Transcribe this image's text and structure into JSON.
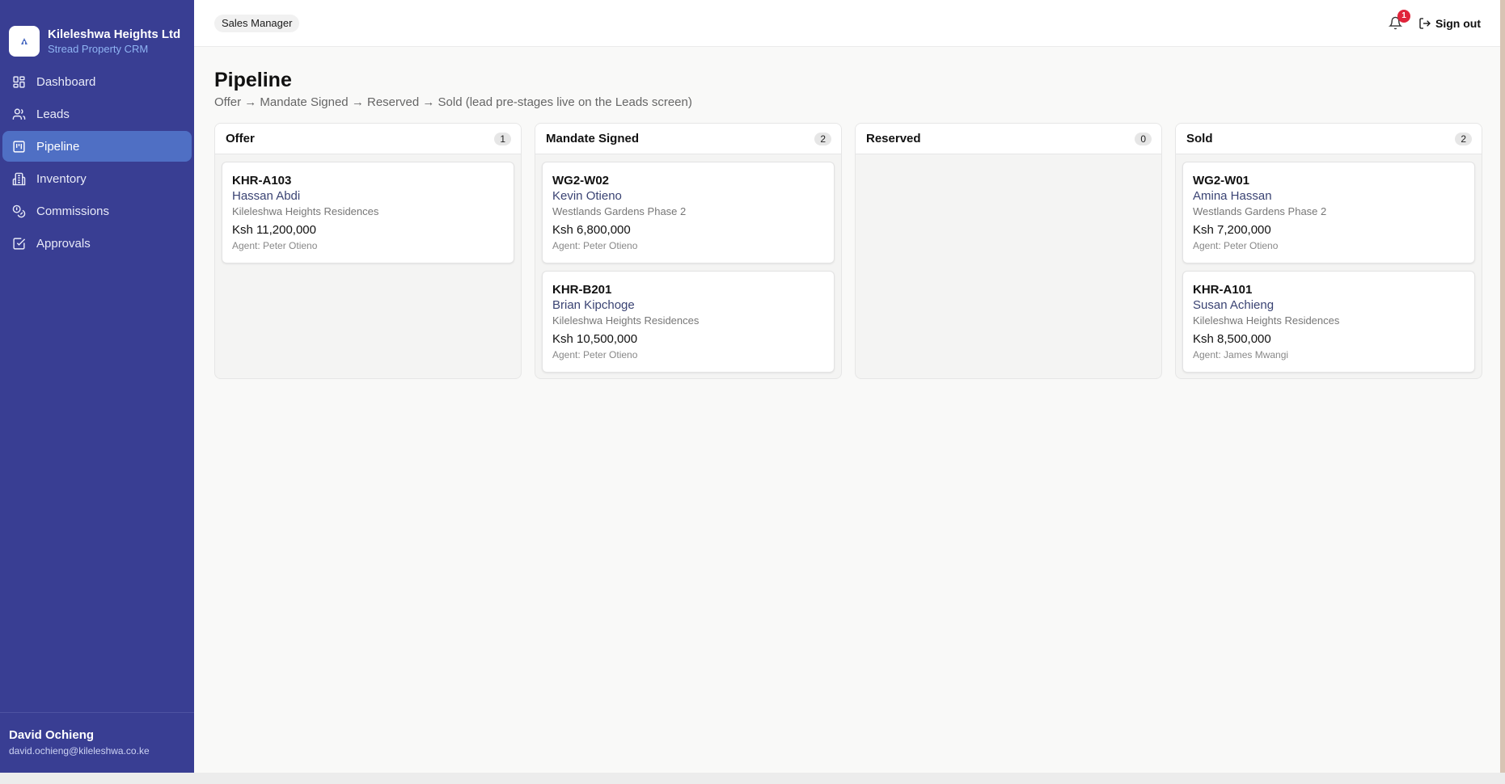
{
  "brand": {
    "name": "Kileleshwa Heights Ltd",
    "subtitle": "Stread Property CRM",
    "logo_icon": "building-logo-icon"
  },
  "sidebar": {
    "items": [
      {
        "label": "Dashboard",
        "icon": "dashboard-icon",
        "active": false
      },
      {
        "label": "Leads",
        "icon": "users-icon",
        "active": false
      },
      {
        "label": "Pipeline",
        "icon": "kanban-icon",
        "active": true
      },
      {
        "label": "Inventory",
        "icon": "building-icon",
        "active": false
      },
      {
        "label": "Commissions",
        "icon": "coins-icon",
        "active": false
      },
      {
        "label": "Approvals",
        "icon": "checkbox-icon",
        "active": false
      }
    ],
    "user": {
      "name": "David Ochieng",
      "email": "david.ochieng@kileleshwa.co.ke"
    }
  },
  "topbar": {
    "role": "Sales Manager",
    "notification_count": "1",
    "sign_out_label": "Sign out"
  },
  "page": {
    "title": "Pipeline",
    "subtitle": "Offer → Mandate Signed → Reserved → Sold (lead pre-stages live on the Leads screen)"
  },
  "columns": [
    {
      "title": "Offer",
      "count": "1",
      "cards": [
        {
          "unit": "KHR-A103",
          "client": "Hassan Abdi",
          "project": "Kileleshwa Heights Residences",
          "price": "Ksh 11,200,000",
          "agent": "Agent: Peter Otieno"
        }
      ]
    },
    {
      "title": "Mandate Signed",
      "count": "2",
      "cards": [
        {
          "unit": "WG2-W02",
          "client": "Kevin Otieno",
          "project": "Westlands Gardens Phase 2",
          "price": "Ksh 6,800,000",
          "agent": "Agent: Peter Otieno"
        },
        {
          "unit": "KHR-B201",
          "client": "Brian Kipchoge",
          "project": "Kileleshwa Heights Residences",
          "price": "Ksh 10,500,000",
          "agent": "Agent: Peter Otieno"
        }
      ]
    },
    {
      "title": "Reserved",
      "count": "0",
      "cards": []
    },
    {
      "title": "Sold",
      "count": "2",
      "cards": [
        {
          "unit": "WG2-W01",
          "client": "Amina Hassan",
          "project": "Westlands Gardens Phase 2",
          "price": "Ksh 7,200,000",
          "agent": "Agent: Peter Otieno"
        },
        {
          "unit": "KHR-A101",
          "client": "Susan Achieng",
          "project": "Kileleshwa Heights Residences",
          "price": "Ksh 8,500,000",
          "agent": "Agent: James Mwangi"
        }
      ]
    }
  ],
  "colors": {
    "sidebar_bg": "#393e93",
    "active_nav": "#4f6fc4",
    "brand_sub": "#8fb4f3",
    "badge_red": "#e0243a"
  }
}
